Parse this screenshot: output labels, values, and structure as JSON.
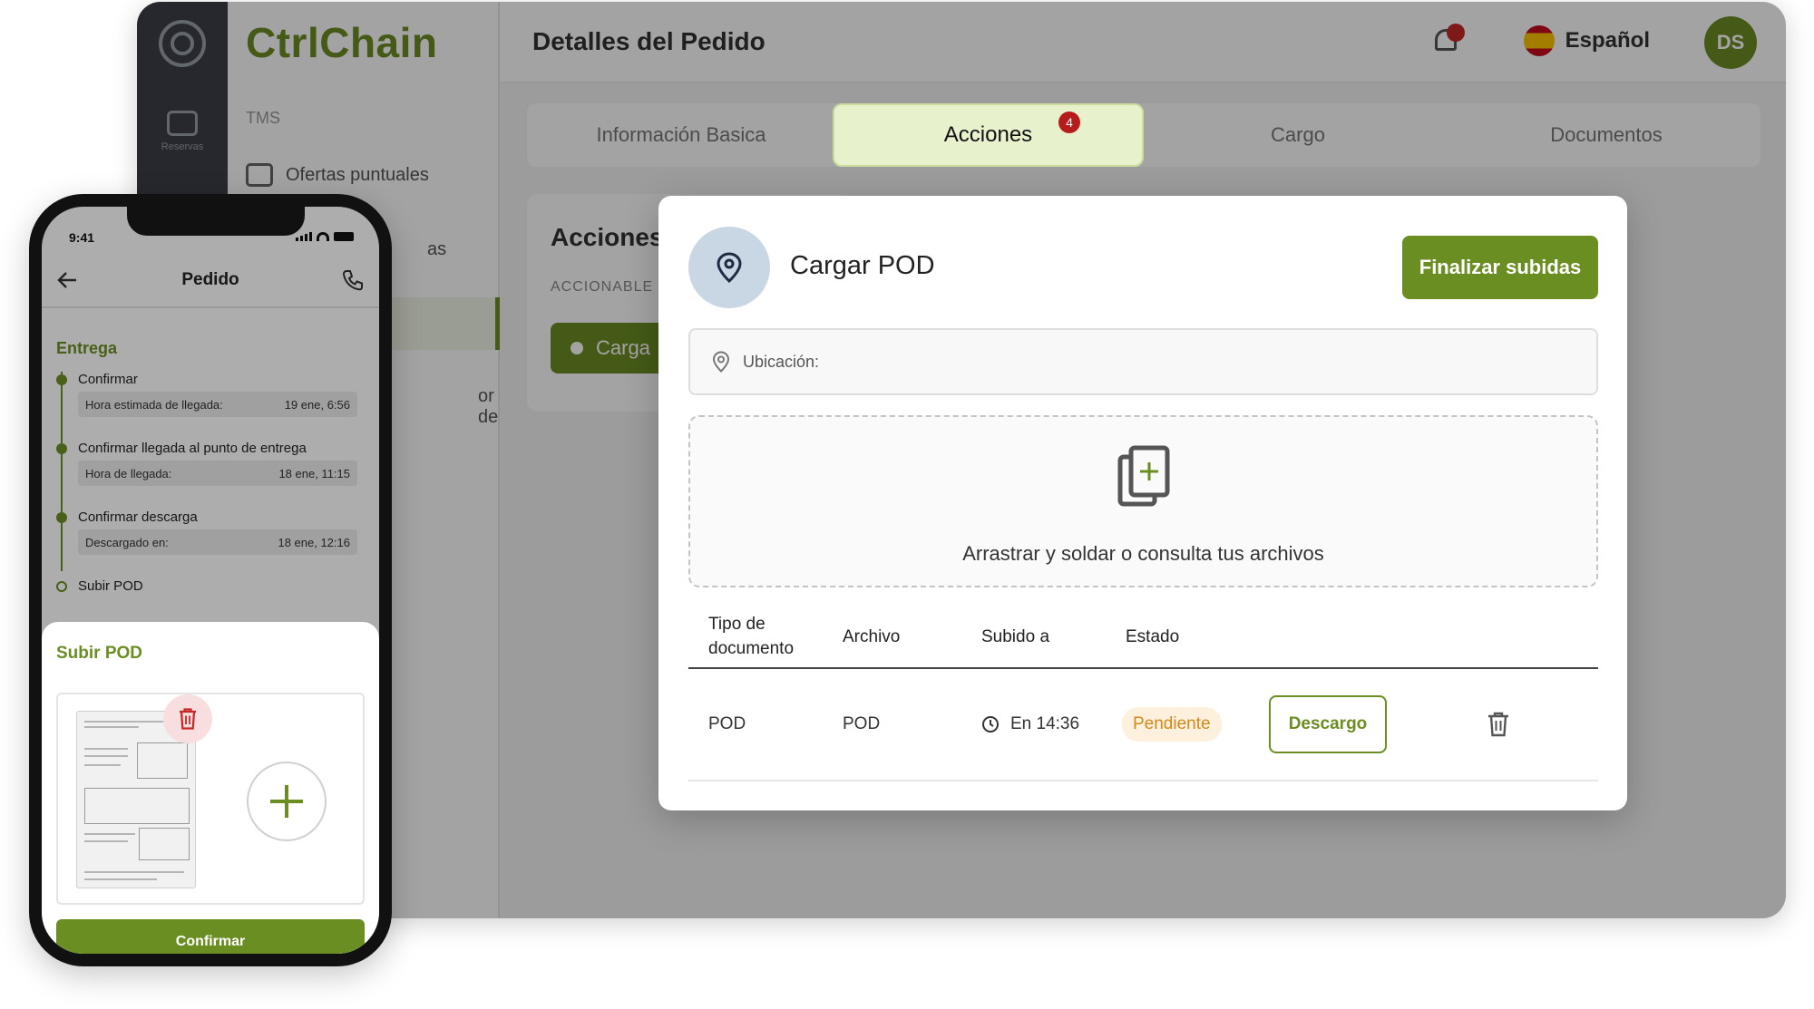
{
  "desktop": {
    "app_name": "CtrlChain",
    "page_title": "Detalles del Pedido",
    "language": "Español",
    "avatar_initials": "DS",
    "rail_items": [
      "Reservas"
    ],
    "sidebar": {
      "section": "TMS",
      "items": [
        "Ofertas puntuales",
        "as",
        "",
        "or de"
      ]
    },
    "tabs": [
      {
        "label": "Información Basica"
      },
      {
        "label": "Acciones",
        "badge": "4",
        "active": true
      },
      {
        "label": "Cargo"
      },
      {
        "label": "Documentos"
      }
    ],
    "actions_panel": {
      "title": "Acciones",
      "subtitle": "ACCIONABLE",
      "button": "Carga"
    }
  },
  "modal": {
    "title": "Cargar POD",
    "icon": "location-pin-icon",
    "finish_button": "Finalizar subidas",
    "location_label": "Ubicación:",
    "dropzone_text": "Arrastrar y soldar o consulta tus archivos",
    "table": {
      "headers": [
        "Tipo de documento",
        "Archivo",
        "Subido a",
        "Estado"
      ],
      "rows": [
        {
          "type": "POD",
          "file": "POD",
          "uploaded": "En 14:36",
          "status": "Pendiente",
          "action": "Descargo"
        }
      ]
    }
  },
  "phone": {
    "time": "9:41",
    "title": "Pedido",
    "section": "Entrega",
    "steps": [
      {
        "label": "Confirmar",
        "info_label": "Hora estimada de llegada:",
        "info_value": "19 ene, 6:56"
      },
      {
        "label": "Confirmar llegada al punto de entrega",
        "info_label": "Hora de llegada:",
        "info_value": "18 ene, 11:15"
      },
      {
        "label": "Confirmar descarga",
        "info_label": "Descargado en:",
        "info_value": "18 ene, 12:16"
      },
      {
        "label": "Subir POD"
      }
    ],
    "sheet": {
      "title": "Subir POD",
      "confirm_button": "Confirmar"
    }
  },
  "colors": {
    "brand_green": "#6b8e23",
    "active_tab": "#e7f2cd",
    "pending_bg": "#fdf0dd",
    "pending_text": "#d08a1a",
    "badge_red": "#b71c1c"
  }
}
